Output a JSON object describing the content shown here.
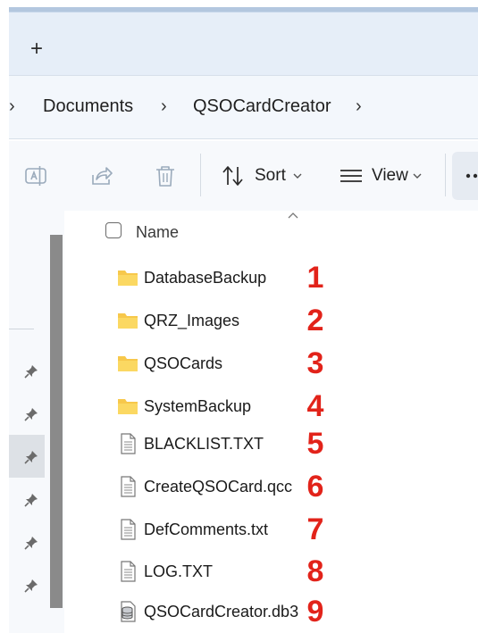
{
  "tabbar": {
    "new_tab_label": "+"
  },
  "breadcrumb": {
    "items": [
      "Documents",
      "QSOCardCreator"
    ]
  },
  "commandbar": {
    "sort_label": "Sort",
    "view_label": "View"
  },
  "file_list": {
    "column_name": "Name",
    "files": [
      {
        "name": "DatabaseBackup",
        "type": "folder",
        "marker": "1"
      },
      {
        "name": "QRZ_Images",
        "type": "folder",
        "marker": "2"
      },
      {
        "name": "QSOCards",
        "type": "folder",
        "marker": "3"
      },
      {
        "name": "SystemBackup",
        "type": "folder",
        "marker": "4"
      },
      {
        "name": "BLACKLIST.TXT",
        "type": "text-file",
        "marker": "5"
      },
      {
        "name": "CreateQSOCard.qcc",
        "type": "text-file",
        "marker": "6"
      },
      {
        "name": "DefComments.txt",
        "type": "text-file",
        "marker": "7"
      },
      {
        "name": "LOG.TXT",
        "type": "text-file",
        "marker": "8"
      },
      {
        "name": "QSOCardCreator.db3",
        "type": "database-file",
        "marker": "9"
      }
    ]
  },
  "colors": {
    "marker_red": "#e2231a",
    "folder_yellow": "#f7c84b",
    "tabstrip_blue": "#e6eef8"
  }
}
